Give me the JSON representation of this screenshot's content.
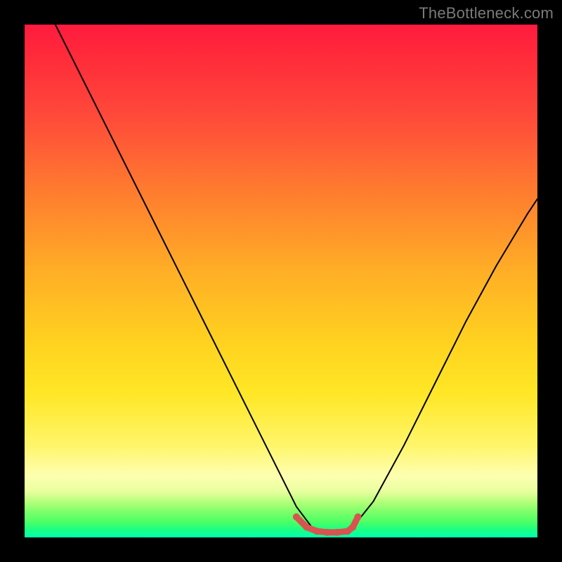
{
  "watermark": "TheBottleneck.com",
  "chart_data": {
    "type": "line",
    "title": "",
    "xlabel": "",
    "ylabel": "",
    "xlim": [
      0,
      100
    ],
    "ylim": [
      0,
      100
    ],
    "grid": false,
    "series": [
      {
        "name": "black-curve",
        "color": "#000000",
        "x": [
          6,
          12,
          18,
          24,
          30,
          36,
          42,
          48,
          53,
          56,
          58,
          60,
          62,
          64,
          68,
          74,
          80,
          86,
          92,
          98,
          100
        ],
        "y": [
          100,
          88,
          76,
          64,
          52,
          40,
          28,
          16,
          6,
          2,
          1,
          1,
          1,
          2,
          7,
          18,
          30,
          42,
          53,
          63,
          66
        ]
      },
      {
        "name": "red-valley-marker",
        "color": "#d9534f",
        "x": [
          53,
          55,
          57,
          59,
          61,
          63,
          64,
          65
        ],
        "y": [
          4,
          2,
          1.2,
          1,
          1,
          1.2,
          2,
          4
        ]
      }
    ],
    "annotations": []
  }
}
